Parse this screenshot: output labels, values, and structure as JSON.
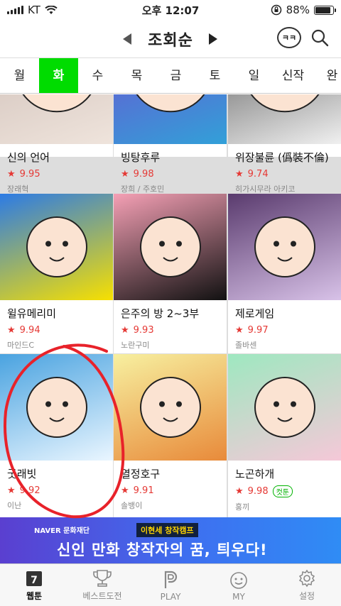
{
  "status": {
    "carrier": "KT",
    "time": "오후 12:07",
    "battery_text": "88%",
    "battery_level": 0.88
  },
  "header": {
    "title": "조회순",
    "chat_label": "ㅋㅋ"
  },
  "days": [
    "월",
    "화",
    "수",
    "목",
    "금",
    "토",
    "일",
    "신작",
    "완"
  ],
  "active_day": 1,
  "comics": [
    {
      "title": "신의 언어",
      "rating": "9.95",
      "author": "장래혁",
      "badge": "",
      "colors": [
        "#c8b7b0",
        "#efe4dc"
      ]
    },
    {
      "title": "빙탕후루",
      "rating": "9.98",
      "author": "장희 / 주호민",
      "badge": "",
      "colors": [
        "#7b3fd0",
        "#32a0d8"
      ]
    },
    {
      "title": "위장불륜 (僞裝不倫)",
      "rating": "9.74",
      "author": "히가시무라 아키코",
      "badge": "",
      "colors": [
        "#3a3a3a",
        "#f0f0f0"
      ]
    },
    {
      "title": "윌유메리미",
      "rating": "9.94",
      "author": "마인드C",
      "badge": "",
      "colors": [
        "#2c7be5",
        "#f7e000"
      ]
    },
    {
      "title": "은주의 방 2~3부",
      "rating": "9.93",
      "author": "노란구미",
      "badge": "",
      "colors": [
        "#f5a0b5",
        "#111111"
      ]
    },
    {
      "title": "제로게임",
      "rating": "9.97",
      "author": "졸바센",
      "badge": "",
      "colors": [
        "#5a3b6e",
        "#d8c2e8"
      ]
    },
    {
      "title": "굿래빗",
      "rating": "9.92",
      "author": "이난",
      "badge": "",
      "colors": [
        "#4aa3e0",
        "#eaf6ff"
      ]
    },
    {
      "title": "열정호구",
      "rating": "9.91",
      "author": "솔뱅이",
      "badge": "",
      "colors": [
        "#f7f0a0",
        "#e88a3a"
      ]
    },
    {
      "title": "노곤하개",
      "rating": "9.98",
      "author": "홍끼",
      "badge": "컷툰",
      "colors": [
        "#9ee8c0",
        "#f5c8d8"
      ]
    }
  ],
  "banner": {
    "sponsor": "NAVER 문화재단",
    "camp": "이현세 창작캠프",
    "headline": "신인 만화 창작자의 꿈, 틔우다!"
  },
  "tabs": [
    {
      "label": "웹툰",
      "icon": "calendar-icon",
      "badge": "7"
    },
    {
      "label": "베스트도전",
      "icon": "trophy-icon"
    },
    {
      "label": "PLAY",
      "icon": "play-p-icon"
    },
    {
      "label": "MY",
      "icon": "smiley-icon"
    },
    {
      "label": "설정",
      "icon": "gear-icon"
    }
  ],
  "accent_color": "#00dc00",
  "rating_color": "#e53935"
}
